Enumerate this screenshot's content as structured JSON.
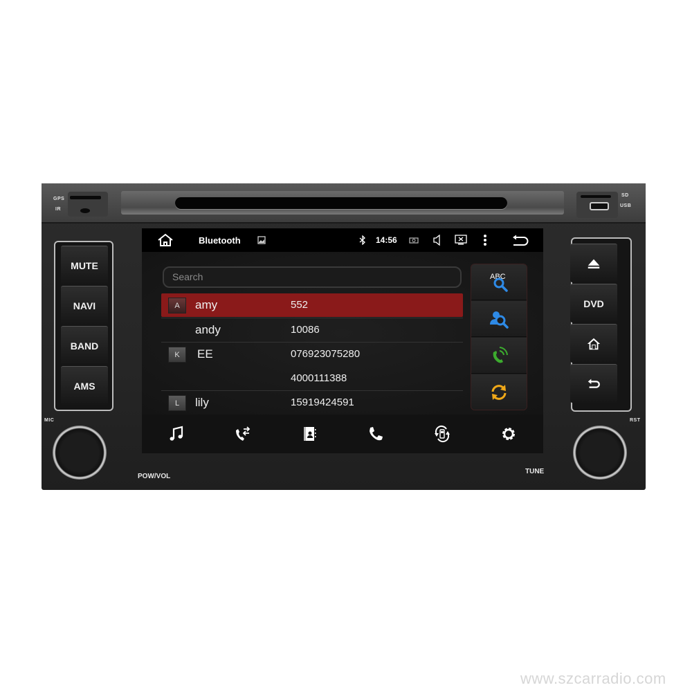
{
  "device": {
    "labels": {
      "gps": "GPS",
      "ir": "IR",
      "sd": "SD",
      "usb": "USB",
      "mic": "MIC",
      "rst": "RST",
      "pow_vol": "POW/VOL",
      "tune": "TUNE"
    },
    "left_buttons": [
      {
        "label": "MUTE"
      },
      {
        "label": "NAVI"
      },
      {
        "label": "BAND"
      },
      {
        "label": "AMS"
      }
    ],
    "right_buttons": [
      {
        "icon": "eject-icon"
      },
      {
        "label": "DVD"
      },
      {
        "icon": "home-icon"
      },
      {
        "icon": "back-icon"
      }
    ]
  },
  "statusbar": {
    "title": "Bluetooth",
    "time": "14:56",
    "icons": [
      "home-icon",
      "image-icon",
      "bluetooth-icon",
      "camera-icon",
      "volume-icon",
      "screen-close-icon",
      "more-vert-icon",
      "back-icon"
    ]
  },
  "contacts": {
    "search_placeholder": "Search",
    "rows": [
      {
        "letter": "A",
        "name": "amy",
        "number": "552",
        "selected": true
      },
      {
        "letter": "",
        "name": "andy",
        "number": "10086",
        "selected": false
      },
      {
        "letter": "K",
        "name": "EE",
        "number": "076923075280",
        "selected": false
      },
      {
        "letter": "",
        "name": "",
        "number": "4000111388",
        "selected": false
      },
      {
        "letter": "L",
        "name": "lily",
        "number": "15919424591",
        "selected": false
      }
    ],
    "side_tools": [
      {
        "icon": "abc-search-icon",
        "text": "ABC"
      },
      {
        "icon": "contact-search-icon"
      },
      {
        "icon": "dial-icon"
      },
      {
        "icon": "sync-icon"
      }
    ]
  },
  "bottombar": {
    "items": [
      "music-icon",
      "call-transfer-icon",
      "phonebook-icon",
      "phone-icon",
      "phone-sync-icon",
      "settings-icon"
    ]
  },
  "colors": {
    "selected_row": "#8a1a1a",
    "tool_blue": "#2e8ae6",
    "tool_green": "#3cab2e",
    "tool_orange": "#f0a818"
  },
  "watermark": "www.szcarradio.com"
}
